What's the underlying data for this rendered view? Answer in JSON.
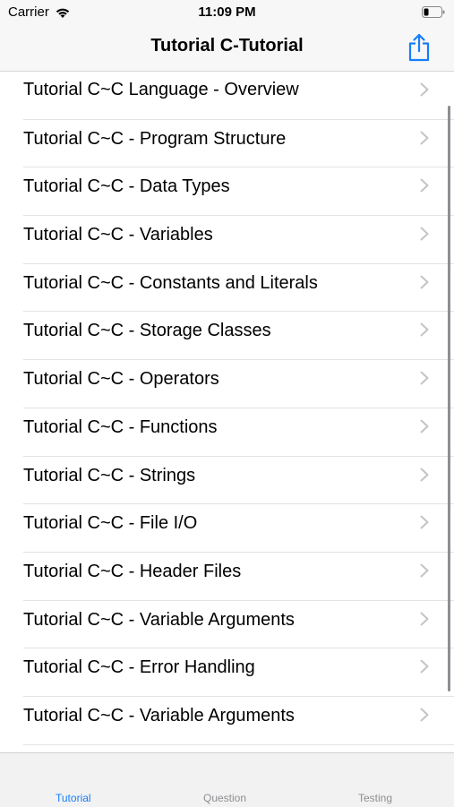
{
  "status_bar": {
    "carrier": "Carrier",
    "time": "11:09 PM",
    "wifi_icon": "wifi-icon",
    "battery_icon": "battery-low-icon"
  },
  "nav": {
    "title": "Tutorial C-Tutorial",
    "share_icon": "share-icon",
    "accent_color": "#157efb"
  },
  "list": {
    "items": [
      {
        "label": "Tutorial C~C Language - Overview"
      },
      {
        "label": "Tutorial C~C - Program Structure"
      },
      {
        "label": "Tutorial C~C - Data Types"
      },
      {
        "label": "Tutorial C~C - Variables"
      },
      {
        "label": "Tutorial C~C - Constants and Literals"
      },
      {
        "label": "Tutorial C~C - Storage Classes"
      },
      {
        "label": "Tutorial C~C - Operators"
      },
      {
        "label": "Tutorial C~C - Functions"
      },
      {
        "label": "Tutorial C~C - Strings"
      },
      {
        "label": "Tutorial C~C - File I/O"
      },
      {
        "label": "Tutorial C~C - Header Files"
      },
      {
        "label": "Tutorial C~C - Variable Arguments"
      },
      {
        "label": "Tutorial C~C - Error Handling"
      },
      {
        "label": "Tutorial C~C - Variable Arguments"
      }
    ],
    "chevron_icon": "chevron-right-icon"
  },
  "tab_bar": {
    "tabs": [
      {
        "label": "Tutorial",
        "active": true
      },
      {
        "label": "Question",
        "active": false
      },
      {
        "label": "Testing",
        "active": false
      }
    ]
  }
}
